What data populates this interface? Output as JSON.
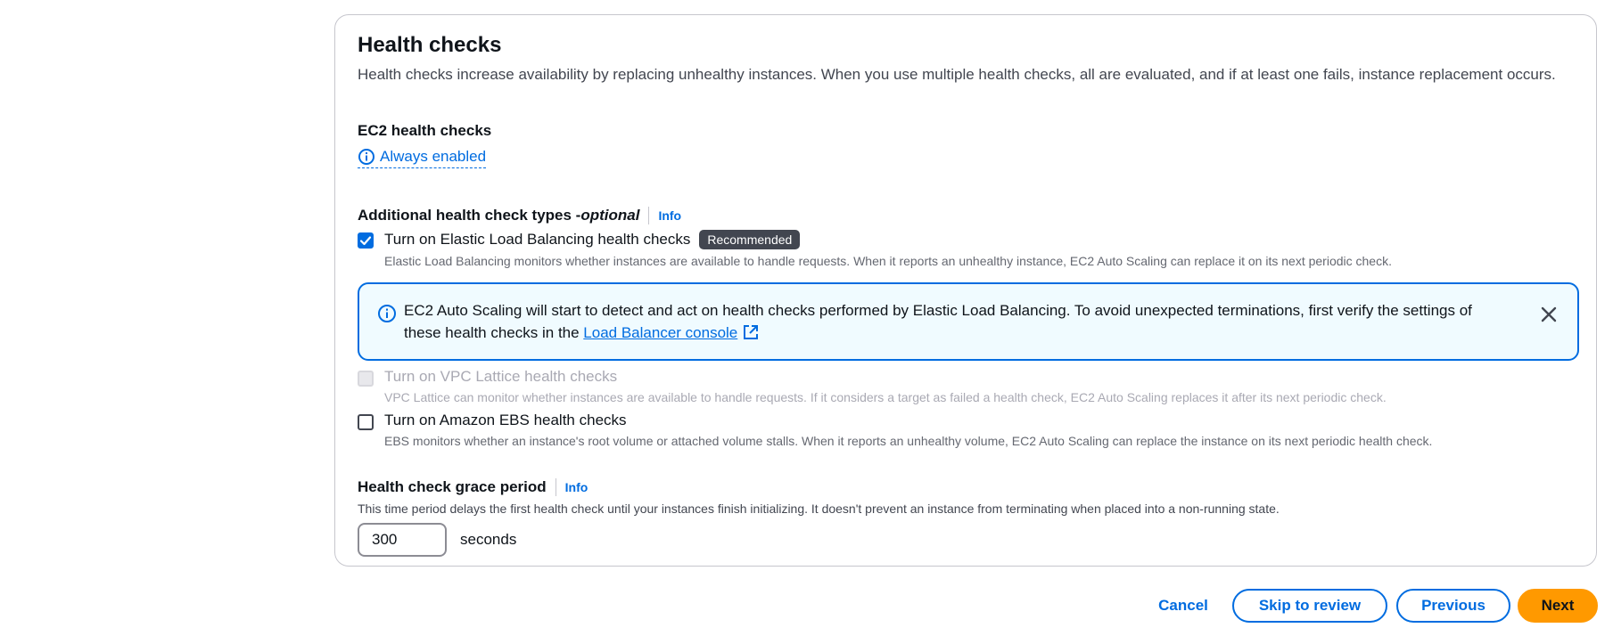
{
  "section": {
    "title": "Health checks",
    "description": "Health checks increase availability by replacing unhealthy instances. When you use multiple health checks, all are evaluated, and if at least one fails, instance replacement occurs."
  },
  "ec2": {
    "label": "EC2 health checks",
    "status_link": "Always enabled",
    "icon": "info-circle-icon"
  },
  "additional": {
    "label_main": "Additional health check types - ",
    "label_optional": "optional",
    "info": "Info"
  },
  "checks": [
    {
      "label": "Turn on Elastic Load Balancing health checks",
      "badge": "Recommended",
      "help": "Elastic Load Balancing monitors whether instances are available to handle requests. When it reports an unhealthy instance, EC2 Auto Scaling can replace it on its next periodic check.",
      "checked": true,
      "disabled": false
    },
    {
      "label": "Turn on VPC Lattice health checks",
      "help": "VPC Lattice can monitor whether instances are available to handle requests. If it considers a target as failed a health check, EC2 Auto Scaling replaces it after its next periodic check.",
      "checked": false,
      "disabled": true
    },
    {
      "label": "Turn on Amazon EBS health checks",
      "help": "EBS monitors whether an instance's root volume or attached volume stalls. When it reports an unhealthy volume, EC2 Auto Scaling can replace the instance on its next periodic health check.",
      "checked": false,
      "disabled": false
    }
  ],
  "alert": {
    "text": "EC2 Auto Scaling will start to detect and act on health checks performed by Elastic Load Balancing. To avoid unexpected terminations, first verify the settings of these health checks in the ",
    "link": "Load Balancer console",
    "icon": "info-circle-icon",
    "close_icon": "close-icon",
    "external_icon": "external-link-icon"
  },
  "grace": {
    "label": "Health check grace period",
    "info": "Info",
    "description": "This time period delays the first health check until your instances finish initializing. It doesn't prevent an instance from terminating when placed into a non-running state.",
    "value": "300",
    "unit": "seconds"
  },
  "footer": {
    "cancel": "Cancel",
    "skip": "Skip to review",
    "previous": "Previous",
    "next": "Next"
  },
  "colors": {
    "accent": "#006ce0",
    "primary_button": "#ff9900",
    "alert_bg": "#f0fbff",
    "badge_bg": "#424650"
  }
}
